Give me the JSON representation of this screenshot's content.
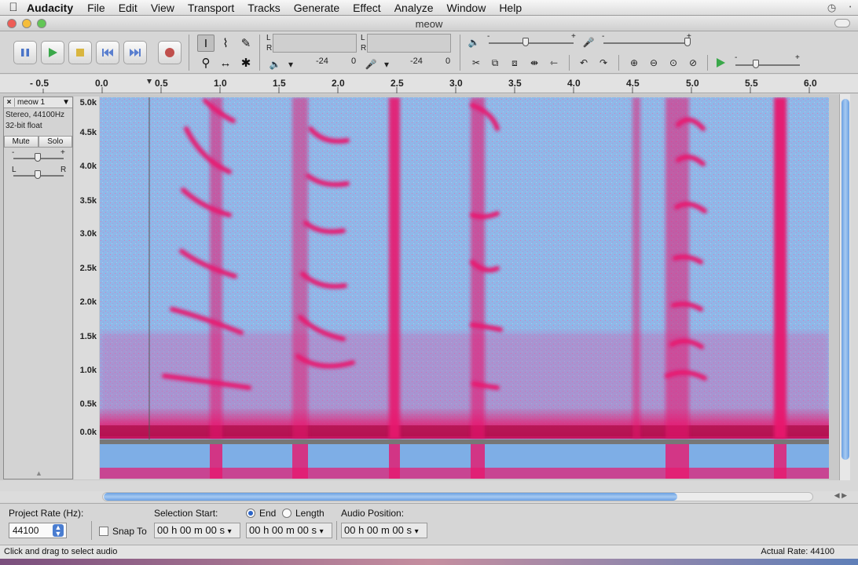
{
  "menubar": {
    "app_name": "Audacity",
    "menus": [
      "File",
      "Edit",
      "View",
      "Transport",
      "Tracks",
      "Generate",
      "Effect",
      "Analyze",
      "Window",
      "Help"
    ]
  },
  "window": {
    "title": "meow"
  },
  "toolbar": {
    "meter_left_label": "L",
    "meter_right_label": "R",
    "play_meter_db": "-24",
    "play_meter_zero": "0",
    "rec_meter_db": "-24",
    "rec_meter_zero": "0",
    "slider_minus": "-",
    "slider_plus": "+"
  },
  "ruler": {
    "ticks": [
      "- 0.5",
      "0.0",
      "0.5",
      "1.0",
      "1.5",
      "2.0",
      "2.5",
      "3.0",
      "3.5",
      "4.0",
      "4.5",
      "5.0",
      "5.5",
      "6.0"
    ]
  },
  "track": {
    "name": "meow 1",
    "close": "×",
    "format": "Stereo, 44100Hz",
    "sample_format": "32-bit float",
    "mute_label": "Mute",
    "solo_label": "Solo",
    "gain_minus": "-",
    "gain_plus": "+",
    "pan_left": "L",
    "pan_right": "R",
    "freq_labels": [
      "5.0k",
      "4.5k",
      "4.0k",
      "3.5k",
      "3.0k",
      "2.5k",
      "2.0k",
      "1.5k",
      "1.0k",
      "0.5k",
      "0.0k"
    ]
  },
  "selection_bar": {
    "project_rate_label": "Project Rate (Hz):",
    "project_rate_value": "44100",
    "snap_to_label": "Snap To",
    "selection_start_label": "Selection Start:",
    "end_label": "End",
    "length_label": "Length",
    "audio_position_label": "Audio Position:",
    "selection_start_value": "00 h 00 m 00 s",
    "end_value": "00 h 00 m 00 s",
    "audio_position_value": "00 h 00 m 00 s"
  },
  "status": {
    "message": "Click and drag to select audio",
    "actual_rate": "Actual Rate: 44100"
  },
  "colors": {
    "spectrogram_background": "#8fb8e8",
    "spectrogram_energy": "#e8186e",
    "scroll_thumb": "#6aa0e2"
  }
}
